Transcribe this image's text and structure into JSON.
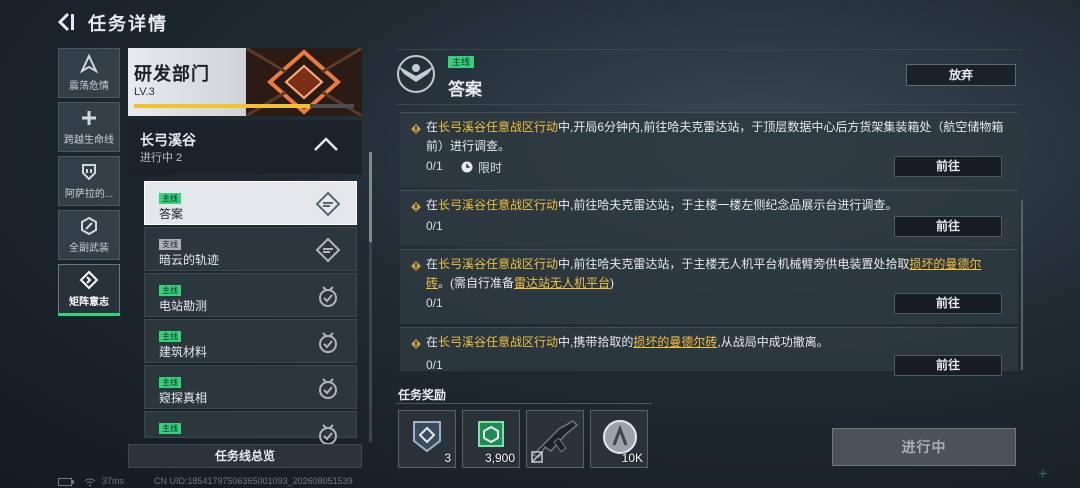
{
  "header": {
    "title": "任务详情"
  },
  "tabs": [
    {
      "label": "震荡危情",
      "icon": "triangle-a-icon"
    },
    {
      "label": "跨越生命线",
      "icon": "plus-cross-icon"
    },
    {
      "label": "阿萨拉的...",
      "icon": "shield-down-icon"
    },
    {
      "label": "全副武装",
      "icon": "hex-slash-icon"
    },
    {
      "label": "矩阵意志",
      "icon": "diamond-arrows-icon",
      "active": true
    }
  ],
  "department": {
    "name": "研发部门",
    "level": "LV.3",
    "progress": 0.8
  },
  "group": {
    "name": "长弓溪谷",
    "status": "进行中 2"
  },
  "quests": [
    {
      "tag": "主线",
      "name": "答案",
      "state": "active",
      "selected": true
    },
    {
      "tag": "支线",
      "name": "暗云的轨迹",
      "state": "active"
    },
    {
      "tag": "主线",
      "name": "电站勘测",
      "state": "done"
    },
    {
      "tag": "主线",
      "name": "建筑材料",
      "state": "done"
    },
    {
      "tag": "主线",
      "name": "窥探真相",
      "state": "done"
    },
    {
      "tag": "主线",
      "name": "",
      "state": "done"
    }
  ],
  "overview_button": "任务线总览",
  "detail": {
    "tag": "主线",
    "title": "答案",
    "abandon_label": "放弃",
    "objectives": [
      {
        "parts": [
          {
            "text": "在",
            "style": "n"
          },
          {
            "text": "长弓溪谷任意战区行动",
            "style": "hl"
          },
          {
            "text": "中,开局6分钟内,前往哈夫克雷达站，于顶层数据中心后方货架集装箱处（航空储物箱前）进行调查。",
            "style": "n"
          }
        ],
        "progress": "0/1",
        "limit": "限时",
        "goto": "前往"
      },
      {
        "parts": [
          {
            "text": "在",
            "style": "n"
          },
          {
            "text": "长弓溪谷任意战区行动",
            "style": "hl"
          },
          {
            "text": "中,前往哈夫克雷达站，于主楼一楼左侧纪念品展示台进行调查。",
            "style": "n"
          }
        ],
        "progress": "0/1",
        "goto": "前往"
      },
      {
        "parts": [
          {
            "text": "在",
            "style": "n"
          },
          {
            "text": "长弓溪谷任意战区行动",
            "style": "hl"
          },
          {
            "text": "中,前往哈夫克雷达站，于主楼无人机平台机械臂旁供电装置处拾取",
            "style": "n"
          },
          {
            "text": "损坏的曼德尔砖",
            "style": "ul"
          },
          {
            "text": "。(需自行准备",
            "style": "n"
          },
          {
            "text": "雷达站无人机平台",
            "style": "ul"
          },
          {
            "text": ")",
            "style": "n"
          }
        ],
        "progress": "0/1",
        "goto": "前往"
      },
      {
        "parts": [
          {
            "text": "在",
            "style": "n"
          },
          {
            "text": "长弓溪谷任意战区行动",
            "style": "hl"
          },
          {
            "text": "中,携带拾取的",
            "style": "n"
          },
          {
            "text": "损坏的曼德尔砖",
            "style": "ul"
          },
          {
            "text": ",从战局中成功撤离。",
            "style": "n"
          }
        ],
        "progress": "0/1",
        "goto": "前往"
      }
    ]
  },
  "rewards": {
    "title": "任务奖励",
    "items": [
      {
        "icon": "matrix-badge-icon",
        "count": "3"
      },
      {
        "icon": "green-crate-icon",
        "count": "3,900"
      },
      {
        "icon": "rifle-icon",
        "count": ""
      },
      {
        "icon": "silver-coin-icon",
        "count": "10K"
      }
    ]
  },
  "status_button": "进行中",
  "footer": {
    "ping": "37ms",
    "uid": "CN UID:18541797506365001093_202608051539"
  }
}
